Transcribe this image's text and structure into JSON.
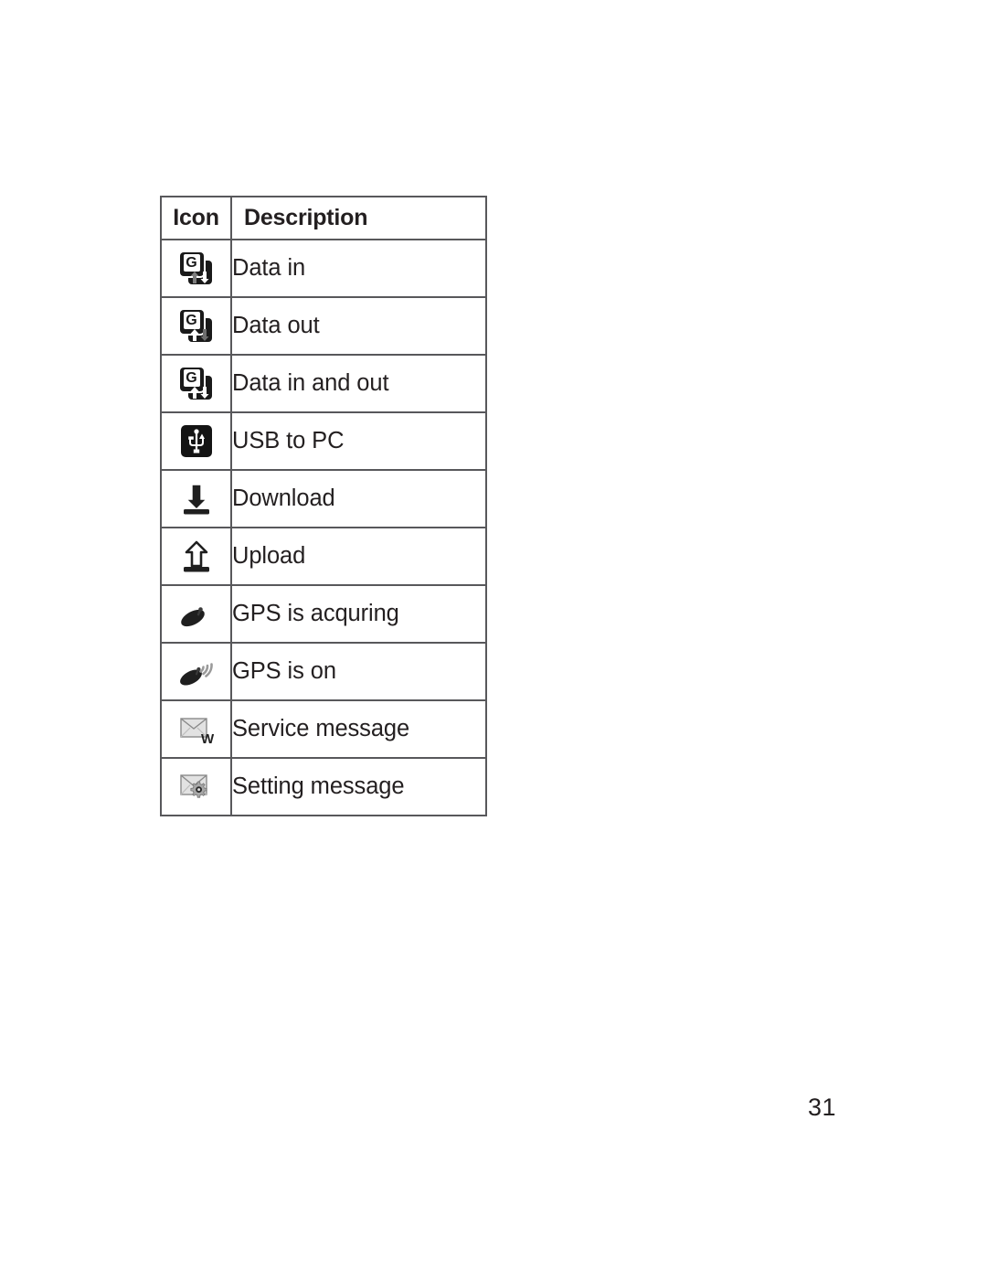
{
  "page": {
    "number": "31"
  },
  "table": {
    "headers": {
      "icon": "Icon",
      "description": "Description"
    },
    "rows": [
      {
        "icon_name": "gprs-data-in-icon",
        "description": "Data in"
      },
      {
        "icon_name": "gprs-data-out-icon",
        "description": "Data out"
      },
      {
        "icon_name": "gprs-data-in-out-icon",
        "description": "Data in and out"
      },
      {
        "icon_name": "usb-to-pc-icon",
        "description": "USB to PC"
      },
      {
        "icon_name": "download-icon",
        "description": "Download"
      },
      {
        "icon_name": "upload-icon",
        "description": "Upload"
      },
      {
        "icon_name": "gps-acquiring-icon",
        "description": "GPS is acquring"
      },
      {
        "icon_name": "gps-on-icon",
        "description": "GPS is on"
      },
      {
        "icon_name": "service-message-icon",
        "description": "Service message"
      },
      {
        "icon_name": "setting-message-icon",
        "description": "Setting message"
      }
    ],
    "gprs_letter": "G",
    "service_message_letter": "W"
  },
  "colors": {
    "text": "#231f20",
    "border": "#58585b",
    "icon_dark": "#1a1a1a",
    "icon_grey": "#9a9a9a",
    "envelope_light": "#d8d8d8"
  }
}
